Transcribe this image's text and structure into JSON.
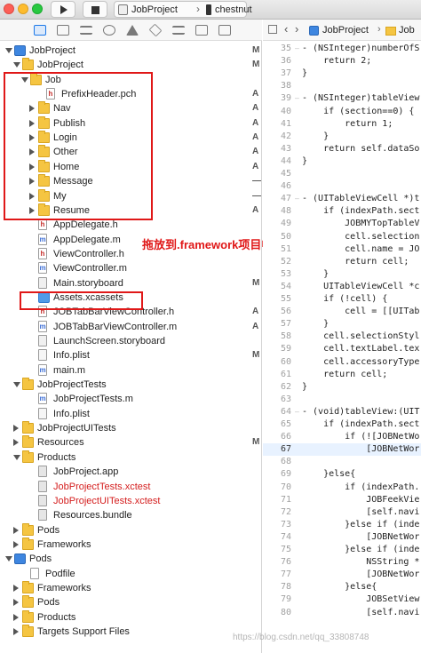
{
  "toolbar": {
    "scheme_target": "JobProject",
    "scheme_device": "chestnut"
  },
  "jumpbar": {
    "project": "JobProject",
    "folder": "Job"
  },
  "navigator": {
    "tabs": [
      "folder-icon",
      "x-square-icon",
      "hierarchy-icon",
      "search-icon",
      "warning-icon",
      "test-diamond-icon",
      "debug-icon",
      "breakpoint-icon",
      "report-icon"
    ],
    "items": [
      {
        "label": "JobProject",
        "icon": "project",
        "indent": 0,
        "disc": "open",
        "status": "M"
      },
      {
        "label": "JobProject",
        "icon": "folder",
        "indent": 1,
        "disc": "open",
        "status": "M"
      },
      {
        "label": "Job",
        "icon": "folder",
        "indent": 2,
        "disc": "open",
        "status": ""
      },
      {
        "label": "PrefixHeader.pch",
        "icon": "h",
        "indent": 4,
        "disc": "",
        "status": "A"
      },
      {
        "label": "Nav",
        "icon": "folder",
        "indent": 3,
        "disc": "closed",
        "status": "A"
      },
      {
        "label": "Publish",
        "icon": "folder",
        "indent": 3,
        "disc": "closed",
        "status": "A"
      },
      {
        "label": "Login",
        "icon": "folder",
        "indent": 3,
        "disc": "closed",
        "status": "A"
      },
      {
        "label": "Other",
        "icon": "folder",
        "indent": 3,
        "disc": "closed",
        "status": "A"
      },
      {
        "label": "Home",
        "icon": "folder",
        "indent": 3,
        "disc": "closed",
        "status": "A"
      },
      {
        "label": "Message",
        "icon": "folder",
        "indent": 3,
        "disc": "closed",
        "status": "—"
      },
      {
        "label": "My",
        "icon": "folder",
        "indent": 3,
        "disc": "closed",
        "status": "—"
      },
      {
        "label": "Resume",
        "icon": "folder",
        "indent": 3,
        "disc": "closed",
        "status": "A"
      },
      {
        "label": "AppDelegate.h",
        "icon": "h",
        "indent": 3,
        "disc": "",
        "status": ""
      },
      {
        "label": "AppDelegate.m",
        "icon": "m",
        "indent": 3,
        "disc": "",
        "status": ""
      },
      {
        "label": "ViewController.h",
        "icon": "h",
        "indent": 3,
        "disc": "",
        "status": ""
      },
      {
        "label": "ViewController.m",
        "icon": "m",
        "indent": 3,
        "disc": "",
        "status": ""
      },
      {
        "label": "Main.storyboard",
        "icon": "sb",
        "indent": 3,
        "disc": "",
        "status": "M"
      },
      {
        "label": "Assets.xcassets",
        "icon": "assets",
        "indent": 3,
        "disc": "",
        "status": ""
      },
      {
        "label": "JOBTabBarViewController.h",
        "icon": "h",
        "indent": 3,
        "disc": "",
        "status": "A"
      },
      {
        "label": "JOBTabBarViewController.m",
        "icon": "m",
        "indent": 3,
        "disc": "",
        "status": "A"
      },
      {
        "label": "LaunchScreen.storyboard",
        "icon": "sb",
        "indent": 3,
        "disc": "",
        "status": ""
      },
      {
        "label": "Info.plist",
        "icon": "pl",
        "indent": 3,
        "disc": "",
        "status": "M"
      },
      {
        "label": "main.m",
        "icon": "m",
        "indent": 3,
        "disc": "",
        "status": ""
      },
      {
        "label": "JobProjectTests",
        "icon": "folder",
        "indent": 1,
        "disc": "open",
        "status": ""
      },
      {
        "label": "JobProjectTests.m",
        "icon": "m",
        "indent": 3,
        "disc": "",
        "status": ""
      },
      {
        "label": "Info.plist",
        "icon": "pl",
        "indent": 3,
        "disc": "",
        "status": ""
      },
      {
        "label": "JobProjectUITests",
        "icon": "folder",
        "indent": 1,
        "disc": "closed",
        "status": ""
      },
      {
        "label": "Resources",
        "icon": "folder",
        "indent": 1,
        "disc": "closed",
        "status": "M"
      },
      {
        "label": "Products",
        "icon": "folder",
        "indent": 1,
        "disc": "open",
        "status": ""
      },
      {
        "label": "JobProject.app",
        "icon": "app",
        "indent": 3,
        "disc": "",
        "status": ""
      },
      {
        "label": "JobProjectTests.xctest",
        "icon": "app",
        "indent": 3,
        "disc": "",
        "status": "",
        "red": true
      },
      {
        "label": "JobProjectUITests.xctest",
        "icon": "app",
        "indent": 3,
        "disc": "",
        "status": "",
        "red": true
      },
      {
        "label": "Resources.bundle",
        "icon": "app",
        "indent": 3,
        "disc": "",
        "status": ""
      },
      {
        "label": "Pods",
        "icon": "folder",
        "indent": 1,
        "disc": "closed",
        "status": ""
      },
      {
        "label": "Frameworks",
        "icon": "folder",
        "indent": 1,
        "disc": "closed",
        "status": ""
      },
      {
        "label": "Pods",
        "icon": "project",
        "indent": 0,
        "disc": "open",
        "status": ""
      },
      {
        "label": "Podfile",
        "icon": "pod",
        "indent": 2,
        "disc": "",
        "status": ""
      },
      {
        "label": "Frameworks",
        "icon": "folder",
        "indent": 1,
        "disc": "closed",
        "status": ""
      },
      {
        "label": "Pods",
        "icon": "folder",
        "indent": 1,
        "disc": "closed",
        "status": ""
      },
      {
        "label": "Products",
        "icon": "folder",
        "indent": 1,
        "disc": "closed",
        "status": ""
      },
      {
        "label": "Targets Support Files",
        "icon": "folder",
        "indent": 1,
        "disc": "closed",
        "status": ""
      }
    ]
  },
  "annotation": "拖放到.framework项目中",
  "code": {
    "highlight_line": "67",
    "lines": [
      {
        "n": "35",
        "f": "—",
        "t": "- (NSInteger)numberOfS"
      },
      {
        "n": "36",
        "f": "",
        "t": "    return 2;"
      },
      {
        "n": "37",
        "f": "",
        "t": "}"
      },
      {
        "n": "38",
        "f": "",
        "t": ""
      },
      {
        "n": "39",
        "f": "—",
        "t": "- (NSInteger)tableView"
      },
      {
        "n": "40",
        "f": "",
        "t": "    if (section==0) {"
      },
      {
        "n": "41",
        "f": "",
        "t": "        return 1;"
      },
      {
        "n": "42",
        "f": "",
        "t": "    }"
      },
      {
        "n": "43",
        "f": "",
        "t": "    return self.dataSo"
      },
      {
        "n": "44",
        "f": "",
        "t": "}"
      },
      {
        "n": "45",
        "f": "",
        "t": ""
      },
      {
        "n": "46",
        "f": "",
        "t": ""
      },
      {
        "n": "47",
        "f": "—",
        "t": "- (UITableViewCell *)t"
      },
      {
        "n": "48",
        "f": "",
        "t": "    if (indexPath.sect"
      },
      {
        "n": "49",
        "f": "",
        "t": "        JOBMYTopTableV"
      },
      {
        "n": "50",
        "f": "",
        "t": "        cell.selection"
      },
      {
        "n": "51",
        "f": "",
        "t": "        cell.name = JO"
      },
      {
        "n": "52",
        "f": "",
        "t": "        return cell;"
      },
      {
        "n": "53",
        "f": "",
        "t": "    }"
      },
      {
        "n": "54",
        "f": "",
        "t": "    UITableViewCell *c"
      },
      {
        "n": "55",
        "f": "",
        "t": "    if (!cell) {"
      },
      {
        "n": "56",
        "f": "",
        "t": "        cell = [[UITab"
      },
      {
        "n": "57",
        "f": "",
        "t": "    }"
      },
      {
        "n": "58",
        "f": "",
        "t": "    cell.selectionStyl"
      },
      {
        "n": "59",
        "f": "",
        "t": "    cell.textLabel.tex"
      },
      {
        "n": "60",
        "f": "",
        "t": "    cell.accessoryType"
      },
      {
        "n": "61",
        "f": "",
        "t": "    return cell;"
      },
      {
        "n": "62",
        "f": "",
        "t": "}"
      },
      {
        "n": "63",
        "f": "",
        "t": ""
      },
      {
        "n": "64",
        "f": "—",
        "t": "- (void)tableView:(UIT"
      },
      {
        "n": "65",
        "f": "",
        "t": "    if (indexPath.sect"
      },
      {
        "n": "66",
        "f": "",
        "t": "        if (![JOBNetWo"
      },
      {
        "n": "67",
        "f": "",
        "t": "            [JOBNetWor"
      },
      {
        "n": "68",
        "f": "",
        "t": ""
      },
      {
        "n": "69",
        "f": "",
        "t": "    }else{"
      },
      {
        "n": "70",
        "f": "",
        "t": "        if (indexPath."
      },
      {
        "n": "71",
        "f": "",
        "t": "            JOBFeekVie"
      },
      {
        "n": "72",
        "f": "",
        "t": "            [self.navi"
      },
      {
        "n": "73",
        "f": "",
        "t": "        }else if (inde"
      },
      {
        "n": "74",
        "f": "",
        "t": "            [JOBNetWor"
      },
      {
        "n": "75",
        "f": "",
        "t": "        }else if (inde"
      },
      {
        "n": "76",
        "f": "",
        "t": "            NSString *"
      },
      {
        "n": "77",
        "f": "",
        "t": "            [JOBNetWor"
      },
      {
        "n": "78",
        "f": "",
        "t": "        }else{"
      },
      {
        "n": "79",
        "f": "",
        "t": "            JOBSetView"
      },
      {
        "n": "80",
        "f": "",
        "t": "            [self.navi"
      }
    ]
  },
  "watermark": "https://blog.csdn.net/qq_33808748",
  "colors": {
    "annotation_red": "#e01818",
    "folder_yellow": "#f5c542",
    "accent_blue": "#1b78e8"
  }
}
